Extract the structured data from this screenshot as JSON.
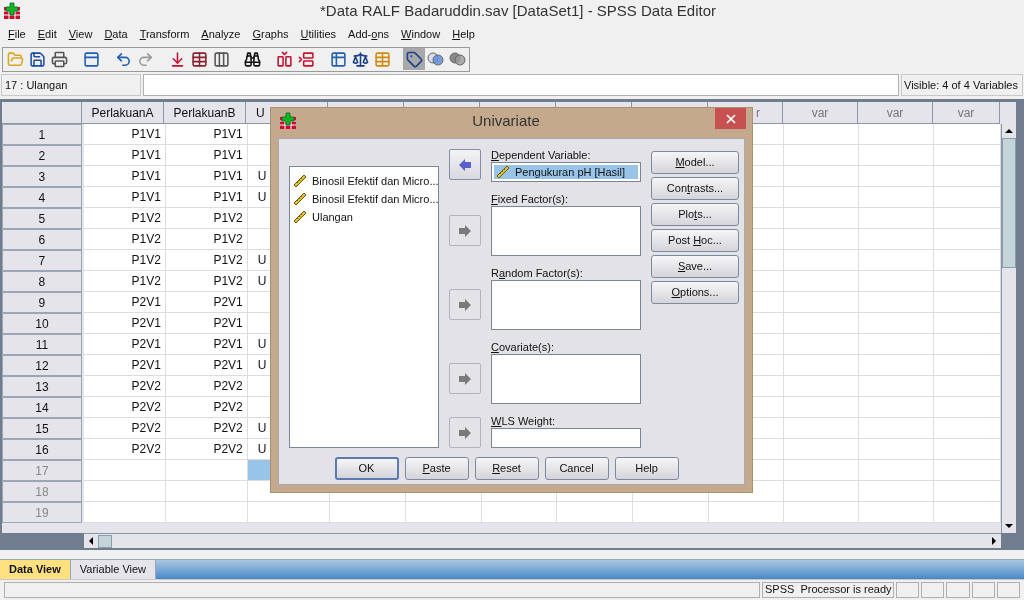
{
  "window": {
    "title": "*Data RALF Badaruddin.sav [DataSet1] - SPSS Data Editor"
  },
  "menu": [
    {
      "key": "F",
      "post": "ile"
    },
    {
      "key": "E",
      "post": "dit"
    },
    {
      "key": "V",
      "post": "iew"
    },
    {
      "key": "D",
      "post": "ata"
    },
    {
      "key": "T",
      "post": "ransform"
    },
    {
      "key": "A",
      "post": "nalyze"
    },
    {
      "key": "G",
      "post": "raphs"
    },
    {
      "key": "U",
      "post": "tilities"
    },
    {
      "pre": "Add-",
      "key": "o",
      "post": "ns"
    },
    {
      "key": "W",
      "post": "indow"
    },
    {
      "key": "H",
      "post": "elp"
    }
  ],
  "toolbar": [
    {
      "kind": "open",
      "pressed": false,
      "disabled": false
    },
    {
      "kind": "save",
      "pressed": false,
      "disabled": false
    },
    {
      "kind": "print",
      "pressed": false,
      "disabled": false
    },
    {
      "kind": "spacer"
    },
    {
      "kind": "dialog",
      "pressed": false,
      "disabled": false
    },
    {
      "kind": "spacer"
    },
    {
      "kind": "undo",
      "pressed": false,
      "disabled": false
    },
    {
      "kind": "redo",
      "pressed": false,
      "disabled": true
    },
    {
      "kind": "spacer"
    },
    {
      "kind": "gotocase",
      "pressed": false,
      "disabled": false
    },
    {
      "kind": "gotovar",
      "pressed": false,
      "disabled": false
    },
    {
      "kind": "variables",
      "pressed": false,
      "disabled": false
    },
    {
      "kind": "spacer"
    },
    {
      "kind": "find",
      "pressed": false,
      "disabled": false
    },
    {
      "kind": "spacer"
    },
    {
      "kind": "insertcase",
      "pressed": false,
      "disabled": false
    },
    {
      "kind": "insertvar",
      "pressed": false,
      "disabled": false
    },
    {
      "kind": "spacer"
    },
    {
      "kind": "split",
      "pressed": false,
      "disabled": false
    },
    {
      "kind": "weight",
      "pressed": false,
      "disabled": false
    },
    {
      "kind": "select",
      "pressed": false,
      "disabled": false
    },
    {
      "kind": "spacer"
    },
    {
      "kind": "labels",
      "pressed": true,
      "disabled": false
    },
    {
      "kind": "sets",
      "pressed": false,
      "disabled": false
    },
    {
      "kind": "sets",
      "pressed": false,
      "disabled": true
    }
  ],
  "cell_ref": "17 : Ulangan",
  "visible_vars": "Visible: 4 of 4 Variables",
  "columns": [
    {
      "name": "PerlakuanA"
    },
    {
      "name": "PerlakuanB"
    },
    {
      "name": "U"
    }
  ],
  "var_columns": [
    "r",
    "var",
    "var",
    "var"
  ],
  "rows": [
    {
      "label": "1",
      "greyed": false,
      "cells": [
        {
          "text": "P1V1",
          "selected": false
        },
        {
          "text": "P1V1",
          "selected": false
        },
        {
          "selected": false
        }
      ]
    },
    {
      "label": "2",
      "greyed": false,
      "cells": [
        {
          "text": "P1V1",
          "selected": false
        },
        {
          "text": "P1V1",
          "selected": false
        },
        {
          "selected": false
        }
      ]
    },
    {
      "label": "3",
      "greyed": false,
      "cells": [
        {
          "text": "P1V1",
          "selected": false
        },
        {
          "text": "P1V1",
          "selected": false
        },
        {
          "text": "U",
          "selected": false
        }
      ]
    },
    {
      "label": "4",
      "greyed": false,
      "cells": [
        {
          "text": "P1V1",
          "selected": false
        },
        {
          "text": "P1V1",
          "selected": false
        },
        {
          "text": "U",
          "selected": false
        }
      ]
    },
    {
      "label": "5",
      "greyed": false,
      "cells": [
        {
          "text": "P1V2",
          "selected": false
        },
        {
          "text": "P1V2",
          "selected": false
        },
        {
          "selected": false
        }
      ]
    },
    {
      "label": "6",
      "greyed": false,
      "cells": [
        {
          "text": "P1V2",
          "selected": false
        },
        {
          "text": "P1V2",
          "selected": false
        },
        {
          "selected": false
        }
      ]
    },
    {
      "label": "7",
      "greyed": false,
      "cells": [
        {
          "text": "P1V2",
          "selected": false
        },
        {
          "text": "P1V2",
          "selected": false
        },
        {
          "text": "U",
          "selected": false
        }
      ]
    },
    {
      "label": "8",
      "greyed": false,
      "cells": [
        {
          "text": "P1V2",
          "selected": false
        },
        {
          "text": "P1V2",
          "selected": false
        },
        {
          "text": "U",
          "selected": false
        }
      ]
    },
    {
      "label": "9",
      "greyed": false,
      "cells": [
        {
          "text": "P2V1",
          "selected": false
        },
        {
          "text": "P2V1",
          "selected": false
        },
        {
          "selected": false
        }
      ]
    },
    {
      "label": "10",
      "greyed": false,
      "cells": [
        {
          "text": "P2V1",
          "selected": false
        },
        {
          "text": "P2V1",
          "selected": false
        },
        {
          "selected": false
        }
      ]
    },
    {
      "label": "11",
      "greyed": false,
      "cells": [
        {
          "text": "P2V1",
          "selected": false
        },
        {
          "text": "P2V1",
          "selected": false
        },
        {
          "text": "U",
          "selected": false
        }
      ]
    },
    {
      "label": "12",
      "greyed": false,
      "cells": [
        {
          "text": "P2V1",
          "selected": false
        },
        {
          "text": "P2V1",
          "selected": false
        },
        {
          "text": "U",
          "selected": false
        }
      ]
    },
    {
      "label": "13",
      "greyed": false,
      "cells": [
        {
          "text": "P2V2",
          "selected": false
        },
        {
          "text": "P2V2",
          "selected": false
        },
        {
          "selected": false
        }
      ]
    },
    {
      "label": "14",
      "greyed": false,
      "cells": [
        {
          "text": "P2V2",
          "selected": false
        },
        {
          "text": "P2V2",
          "selected": false
        },
        {
          "selected": false
        }
      ]
    },
    {
      "label": "15",
      "greyed": false,
      "cells": [
        {
          "text": "P2V2",
          "selected": false
        },
        {
          "text": "P2V2",
          "selected": false
        },
        {
          "text": "U",
          "selected": false
        }
      ]
    },
    {
      "label": "16",
      "greyed": false,
      "cells": [
        {
          "text": "P2V2",
          "selected": false
        },
        {
          "text": "P2V2",
          "selected": false
        },
        {
          "text": "U",
          "selected": false
        }
      ]
    },
    {
      "label": "17",
      "greyed": true,
      "cells": [
        {
          "selected": false
        },
        {
          "selected": false
        },
        {
          "selected": true
        }
      ]
    },
    {
      "label": "18",
      "greyed": true,
      "cells": [
        {
          "selected": false
        },
        {
          "selected": false
        },
        {
          "selected": false
        }
      ]
    },
    {
      "label": "19",
      "greyed": true,
      "cells": [
        {
          "selected": false
        },
        {
          "selected": false
        },
        {
          "selected": false
        }
      ]
    }
  ],
  "view_tabs": [
    {
      "label": "Data View",
      "selected": true
    },
    {
      "label": "Variable View",
      "selected": false
    }
  ],
  "status_bar": {
    "message": "SPSS  Processor is ready"
  },
  "dialog": {
    "title": "Univariate",
    "variables": [
      {
        "label": "Binosil Efektif dan Micro...",
        "selected": false
      },
      {
        "label": "Binosil Efektif dan Micro...",
        "selected": false
      },
      {
        "label": "Ulangan",
        "selected": false
      }
    ],
    "targets": [
      {
        "kind": "single",
        "label": {
          "key": "D",
          "post": "ependent Variable:"
        },
        "arrow_disabled": false,
        "items": [
          {
            "label": "Pengukuran pH [Hasil]",
            "selected": true
          }
        ]
      },
      {
        "kind": "list",
        "label": {
          "key": "F",
          "post": "ixed Factor(s):"
        },
        "arrow_disabled": true
      },
      {
        "kind": "list",
        "label": {
          "pre": "R",
          "key": "a",
          "post": "ndom Factor(s):"
        },
        "arrow_disabled": true
      },
      {
        "kind": "list",
        "label": {
          "key": "C",
          "post": "ovariate(s):"
        },
        "arrow_disabled": true
      },
      {
        "kind": "single",
        "label": {
          "key": "W",
          "post": "LS Weight:"
        },
        "arrow_disabled": true
      }
    ],
    "side_buttons": [
      {
        "key": "M",
        "post": "odel..."
      },
      {
        "pre": "Con",
        "key": "t",
        "post": "rasts..."
      },
      {
        "pre": "Plo",
        "key": "t",
        "post": "s..."
      },
      {
        "pre": "Post ",
        "key": "H",
        "post": "oc..."
      },
      {
        "key": "S",
        "post": "ave..."
      },
      {
        "key": "O",
        "post": "ptions..."
      }
    ],
    "buttons": [
      {
        "label": "OK",
        "default": true
      },
      {
        "key": "P",
        "post": "aste",
        "default": false
      },
      {
        "key": "R",
        "post": "eset",
        "default": false
      },
      {
        "label": "Cancel",
        "default": false
      },
      {
        "label": "Help",
        "default": false
      }
    ]
  }
}
